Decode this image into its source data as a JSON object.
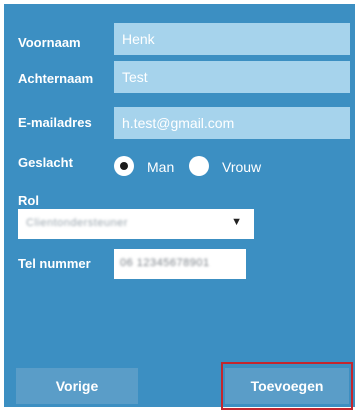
{
  "form": {
    "voornaam": {
      "label": "Voornaam",
      "value": "Henk"
    },
    "achternaam": {
      "label": "Achternaam",
      "value": "Test"
    },
    "email": {
      "label": "E-mailadres",
      "value": "h.test@gmail.com"
    },
    "geslacht": {
      "label": "Geslacht",
      "options": [
        "Man",
        "Vrouw"
      ],
      "selected": "Man"
    },
    "rol": {
      "label": "Rol",
      "value": "Clientondersteuner"
    },
    "tel": {
      "label": "Tel nummer",
      "value": "06 12345678901"
    }
  },
  "buttons": {
    "back_label": "Vorige",
    "submit_label": "Toevoegen"
  },
  "colors": {
    "panel": "#3c8fc2",
    "field": "#a6d3ec",
    "button": "#5a9dc8",
    "highlight": "#c3262e"
  }
}
